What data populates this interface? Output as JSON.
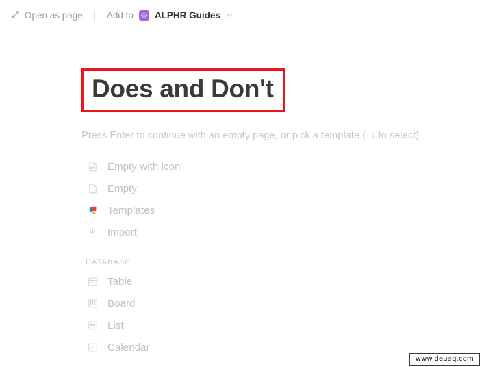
{
  "topbar": {
    "open_as_page_label": "Open as page",
    "open_as_page_icon": "expand-diagonal-icon",
    "add_to_label": "Add to",
    "workspace_name": "ALPHR Guides",
    "workspace_icon": "workspace-gem-icon",
    "chevron_icon": "chevron-down-icon",
    "workspace_icon_color": "#9b6fd0"
  },
  "page": {
    "title": "Does and Don't",
    "title_highlight_color": "#e8161a",
    "hint": "Press Enter to continue with an empty page, or pick a template (↑↓ to select)"
  },
  "template_options": [
    {
      "label": "Empty with icon",
      "icon": "document-lines-icon"
    },
    {
      "label": "Empty",
      "icon": "document-blank-icon"
    },
    {
      "label": "Templates",
      "icon": "shapes-color-icon"
    },
    {
      "label": "Import",
      "icon": "download-arrow-icon"
    }
  ],
  "database_section": {
    "heading": "DATABASE",
    "items": [
      {
        "label": "Table",
        "icon": "table-grid-icon"
      },
      {
        "label": "Board",
        "icon": "board-columns-icon"
      },
      {
        "label": "List",
        "icon": "list-lines-icon"
      },
      {
        "label": "Calendar",
        "icon": "calendar-31-icon"
      }
    ]
  },
  "watermark": {
    "text": "www.deuaq.com"
  }
}
